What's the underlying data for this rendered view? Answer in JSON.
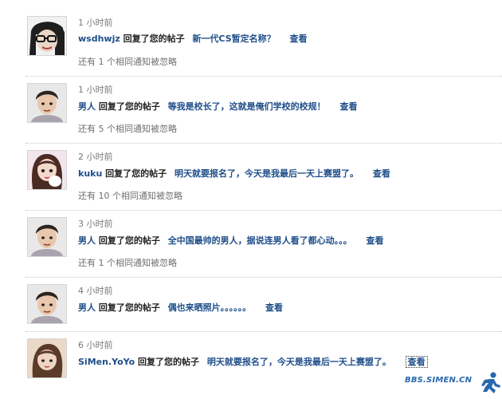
{
  "notifications": [
    {
      "time": "1 小时前",
      "user": "wsdhwjz",
      "verb": "回复了您的帖子",
      "subject": "新一代CS暂定名称？",
      "view": "查看",
      "note": "还有 1 个相同通知被忽略",
      "avatar_icon": "avatar-glasses-icon"
    },
    {
      "time": "1 小时前",
      "user": "男人",
      "verb": "回复了您的帖子",
      "subject": "等我是校长了，这就是俺们学校的校规！",
      "view": "查看",
      "note": "还有 5 个相同通知被忽略",
      "avatar_icon": "avatar-boy-icon"
    },
    {
      "time": "2 小时前",
      "user": "kuku",
      "verb": "回复了您的帖子",
      "subject": "明天就要报名了，今天是我最后一天上赛盟了。",
      "view": "查看",
      "note": "还有 10 个相同通知被忽略",
      "avatar_icon": "avatar-girl-icon"
    },
    {
      "time": "3 小时前",
      "user": "男人",
      "verb": "回复了您的帖子",
      "subject": "全中国最帅的男人，据说连男人看了都心动。。。",
      "view": "查看",
      "note": "还有 1 个相同通知被忽略",
      "avatar_icon": "avatar-boy-icon"
    },
    {
      "time": "4 小时前",
      "user": "男人",
      "verb": "回复了您的帖子",
      "subject": "偶也来晒照片。。。。。。",
      "view": "查看",
      "note": "",
      "avatar_icon": "avatar-boy-icon"
    },
    {
      "time": "6 小时前",
      "user": "SiMen.YoYo",
      "verb": "回复了您的帖子",
      "subject": "明天就要报名了，今天是我最后一天上赛盟了。",
      "view": "查看",
      "note": "",
      "avatar_icon": "avatar-girl-2-icon"
    }
  ],
  "watermark": {
    "text": "BBS.SIMEN.CN",
    "logo_icon": "running-man-logo-icon"
  },
  "colors": {
    "link": "#1f4e8a",
    "muted": "#7a7a7a",
    "watermark": "#2a67ad"
  }
}
